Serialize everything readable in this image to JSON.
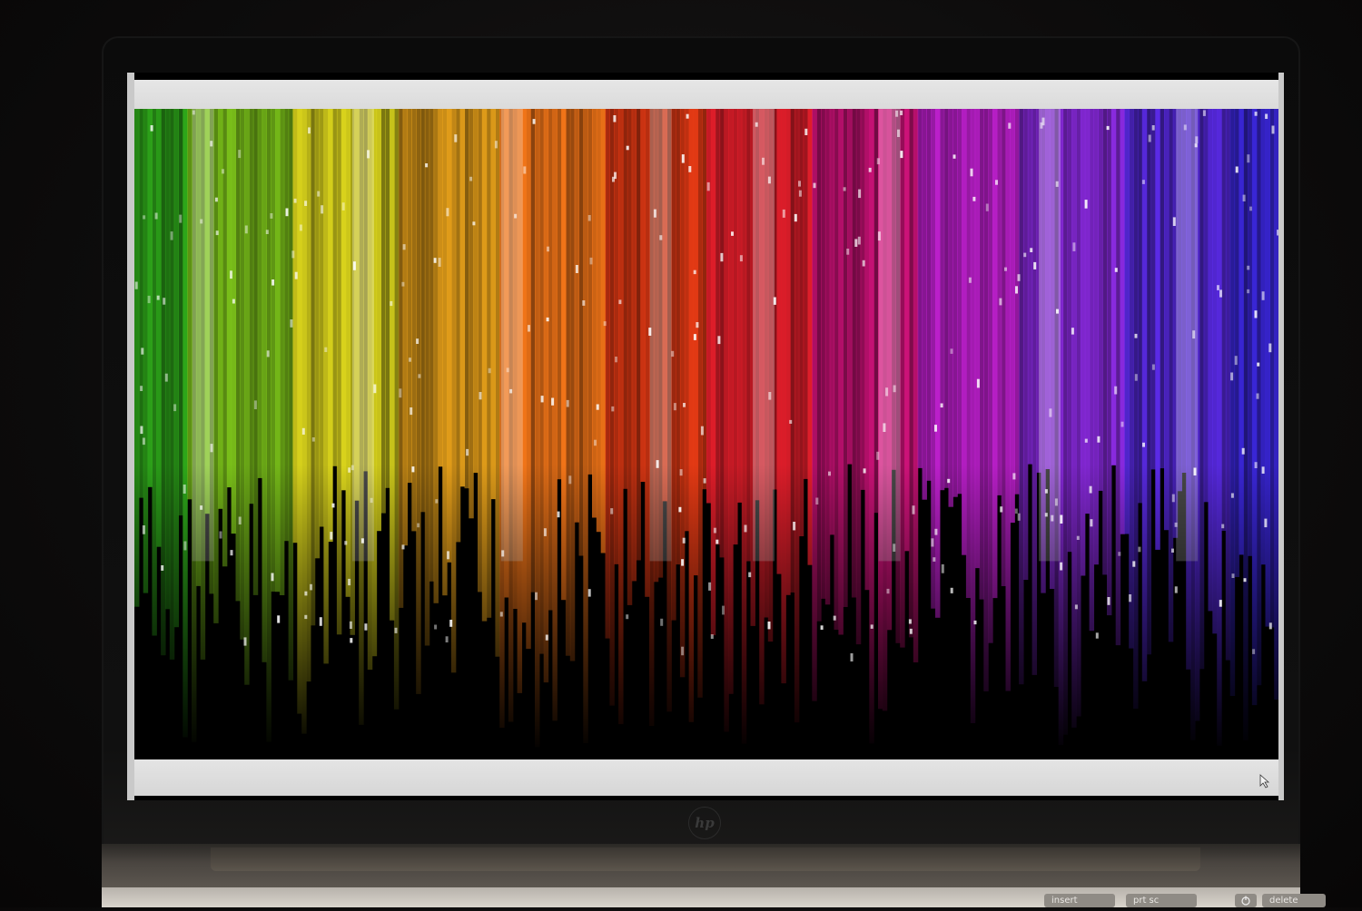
{
  "device": {
    "logo": "hp"
  },
  "keyboard": {
    "keys": [
      "insert",
      "prt sc",
      "delete"
    ]
  },
  "colors": {
    "bars": [
      "#2ea81a",
      "#7cc31a",
      "#d8d21c",
      "#e6a01a",
      "#f07418",
      "#e63a14",
      "#e01e2a",
      "#d0127a",
      "#c020d0",
      "#8a2ae0",
      "#5a2ae6",
      "#3a26d8"
    ],
    "frame": "#d8d8d8"
  },
  "icons": [
    "cursor-icon",
    "power-icon"
  ]
}
